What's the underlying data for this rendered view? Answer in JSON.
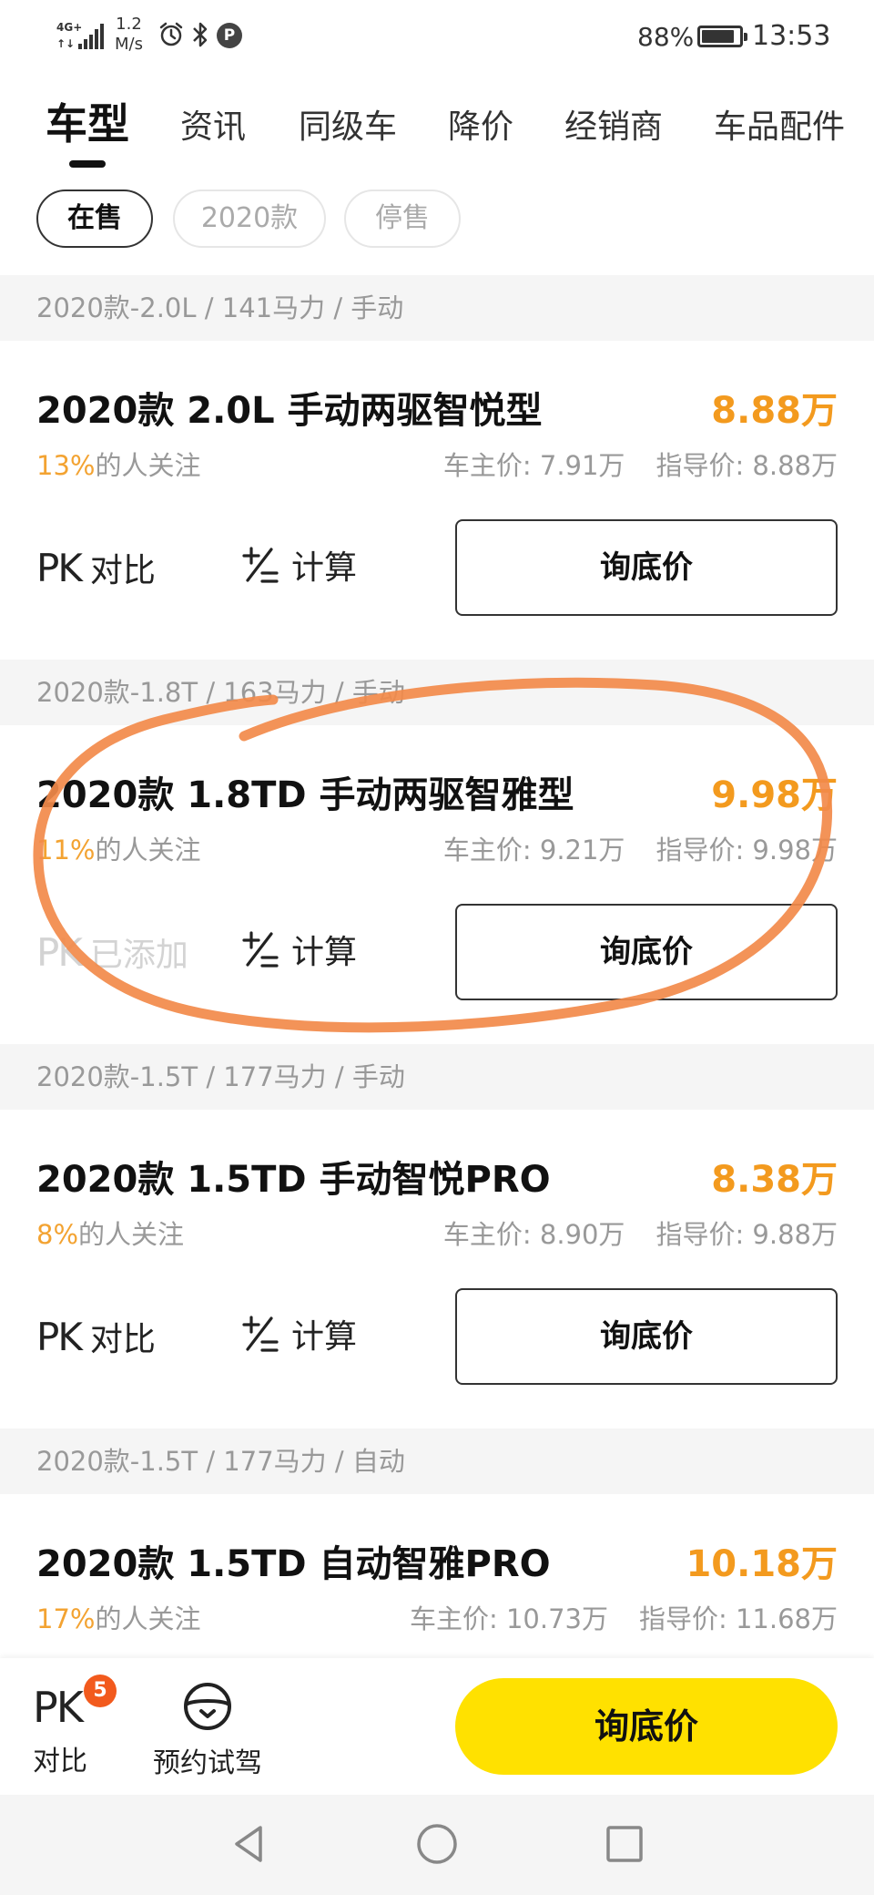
{
  "status_bar": {
    "network": "4G",
    "speed_value": "1.2",
    "speed_unit": "M/s",
    "p_badge": "P",
    "battery_percent": "88%",
    "battery_level": 0.88,
    "time": "13:53",
    "icons": [
      "signal-icon",
      "alarm-icon",
      "bluetooth-icon",
      "battery-icon"
    ]
  },
  "tabs": [
    {
      "label": "车型",
      "active": true
    },
    {
      "label": "资讯",
      "active": false
    },
    {
      "label": "同级车",
      "active": false
    },
    {
      "label": "降价",
      "active": false
    },
    {
      "label": "经销商",
      "active": false
    },
    {
      "label": "车品配件",
      "active": false
    }
  ],
  "filters": [
    {
      "label": "在售",
      "active": true
    },
    {
      "label": "2020款",
      "active": false
    },
    {
      "label": "停售",
      "active": false
    }
  ],
  "groups": [
    {
      "header": "2020款-2.0L / 141马力 / 手动",
      "car": {
        "name": "2020款 2.0L 手动两驱智悦型",
        "price": "8.88万",
        "follow_pct": "13%",
        "follow_text": "的人关注",
        "owner_price": "车主价: 7.91万",
        "guide_price": "指导价: 8.88万",
        "pk_mark": "PK",
        "pk_label": "对比",
        "calc_label": "计算",
        "ask_label": "询底价"
      }
    },
    {
      "header": "2020款-1.8T / 163马力 / 手动",
      "car": {
        "name": "2020款 1.8TD 手动两驱智雅型",
        "price": "9.98万",
        "follow_pct": "11%",
        "follow_text": "的人关注",
        "owner_price": "车主价: 9.21万",
        "guide_price": "指导价: 9.98万",
        "pk_mark": "PK",
        "pk_label": "已添加",
        "calc_label": "计算",
        "ask_label": "询底价"
      }
    },
    {
      "header": "2020款-1.5T / 177马力 / 手动",
      "car": {
        "name": "2020款 1.5TD 手动智悦PRO",
        "price": "8.38万",
        "follow_pct": "8%",
        "follow_text": "的人关注",
        "owner_price": "车主价: 8.90万",
        "guide_price": "指导价: 9.88万",
        "pk_mark": "PK",
        "pk_label": "对比",
        "calc_label": "计算",
        "ask_label": "询底价"
      }
    },
    {
      "header": "2020款-1.5T / 177马力 / 自动",
      "car": {
        "name": "2020款 1.5TD 自动智雅PRO",
        "price": "10.18万",
        "follow_pct": "17%",
        "follow_text": "的人关注",
        "owner_price": "车主价: 10.73万",
        "guide_price": "指导价: 11.68万"
      }
    }
  ],
  "bottom_bar": {
    "pk_mark": "PK",
    "pk_badge": "5",
    "pk_label": "对比",
    "test_drive_label": "预约试驾",
    "ask_label": "询底价"
  },
  "colors": {
    "price": "#f39a1e",
    "follow_pct": "#f3a332",
    "ask_button": "#ffe100",
    "badge": "#f25a1d",
    "annotation": "#f28a4a"
  }
}
